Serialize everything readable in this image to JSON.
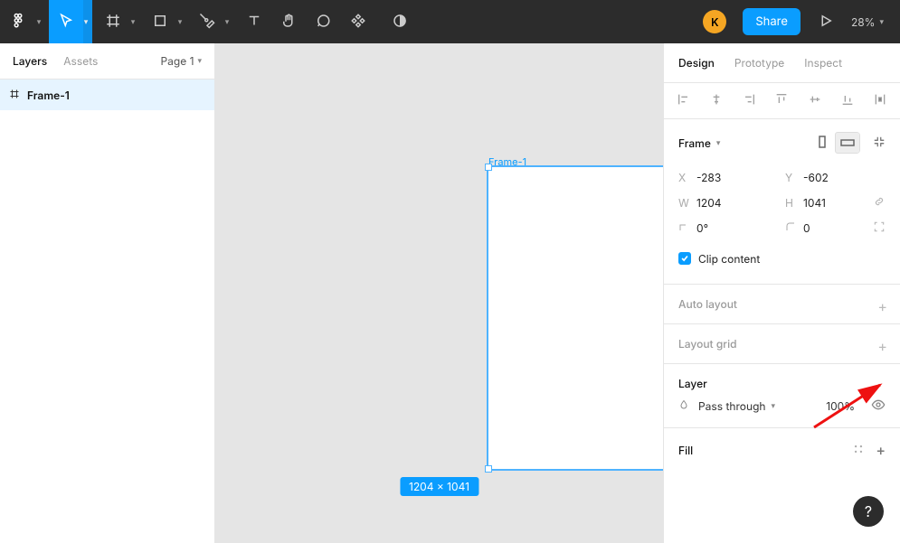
{
  "toolbar": {
    "avatar_initial": "K",
    "share_label": "Share",
    "zoom_label": "28%"
  },
  "left": {
    "tabs": {
      "layers": "Layers",
      "assets": "Assets"
    },
    "page_label": "Page 1",
    "layer_item": "Frame-1"
  },
  "canvas": {
    "frame_label": "Frame-1",
    "dimensions_label": "1204 × 1041"
  },
  "right": {
    "tabs": {
      "design": "Design",
      "prototype": "Prototype",
      "inspect": "Inspect"
    },
    "frame": {
      "label": "Frame",
      "x_key": "X",
      "x_val": "-283",
      "y_key": "Y",
      "y_val": "-602",
      "w_key": "W",
      "w_val": "1204",
      "h_key": "H",
      "h_val": "1041",
      "rot_val": "0°",
      "rad_val": "0",
      "clip_label": "Clip content"
    },
    "auto_layout_label": "Auto layout",
    "layout_grid_label": "Layout grid",
    "layer": {
      "label": "Layer",
      "blend_label": "Pass through",
      "opacity_label": "100%"
    },
    "fill_label": "Fill",
    "help_label": "?"
  }
}
